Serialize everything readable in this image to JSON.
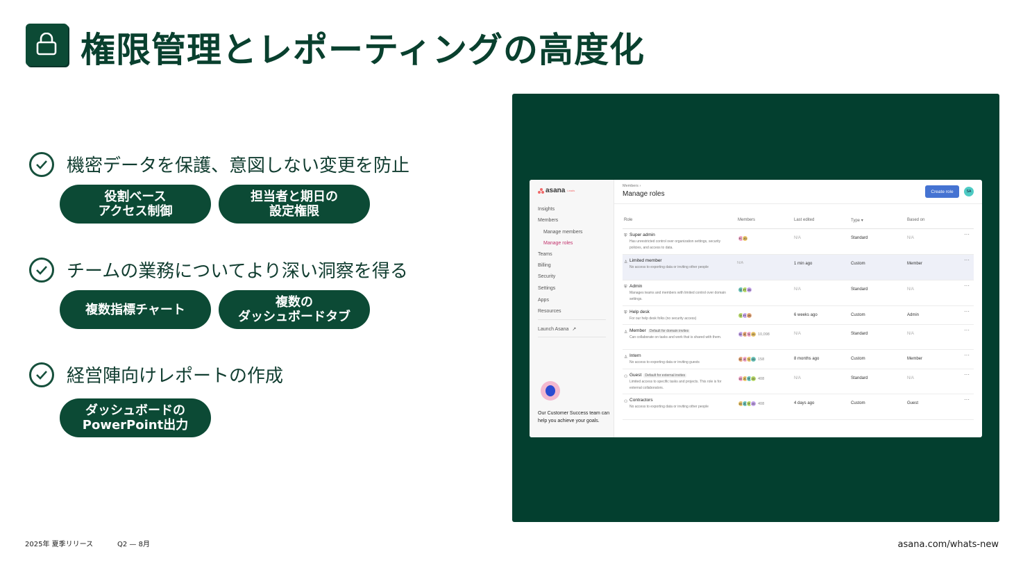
{
  "slide": {
    "title": "権限管理とレポーティングの高度化",
    "bullets": [
      {
        "text": "機密データを保護、意図しない変更を防止",
        "pills": [
          "役割ベース\nアクセス制御",
          "担当者と期日の\n設定権限"
        ]
      },
      {
        "text": "チームの業務についてより深い洞察を得る",
        "pills": [
          "複数指標チャート",
          "複数の\nダッシュボードタブ"
        ]
      },
      {
        "text": "経営陣向けレポートの作成",
        "pills": [
          "ダッシュボードの\nPowerPoint出力"
        ]
      }
    ],
    "footer": {
      "release": "2025年 夏季リリース",
      "period": "Q2 — 8月",
      "url": "asana.com/whats-new"
    },
    "colors": {
      "brand_dark": "#0c4a35",
      "panel": "#033f2f",
      "accent_blue": "#4573d2"
    }
  },
  "app": {
    "logo": "asana",
    "logo_tag": "Leads",
    "sidebar": {
      "items": [
        "Insights",
        "Members",
        "Manage members",
        "Manage roles",
        "Teams",
        "Billing",
        "Security",
        "Settings",
        "Apps",
        "Resources"
      ],
      "launch": "Launch Asana",
      "cs_text": "Our Customer Success team can help you achieve your goals."
    },
    "breadcrumb": "Members",
    "page_title": "Manage roles",
    "create_button": "Create role",
    "user_initials": "SA",
    "columns": [
      "Role",
      "Members",
      "Last edited",
      "Type",
      "Based on"
    ],
    "rows": [
      {
        "name": "Super admin",
        "badge": "",
        "desc": "Has unrestricted control over organization settings, security policies, and access to data.",
        "members": [
          "FG",
          "JD"
        ],
        "member_count": "",
        "last_edited": "N/A",
        "type": "Standard",
        "based_on": "N/A"
      },
      {
        "name": "Limited member",
        "badge": "",
        "desc": "No access to exporting data or inviting other people",
        "members": [],
        "member_count": "N/A",
        "last_edited": "1 min ago",
        "type": "Custom",
        "based_on": "Member"
      },
      {
        "name": "Admin",
        "badge": "",
        "desc": "Manages teams and members with limited control over domain settings.",
        "members": [
          "TA",
          "FF",
          "JB"
        ],
        "member_count": "",
        "last_edited": "N/A",
        "type": "Standard",
        "based_on": "N/A"
      },
      {
        "name": "Help desk",
        "badge": "",
        "desc": "For our help desk folks (no security access)",
        "members": [
          "TA",
          "FF",
          "JB"
        ],
        "member_count": "",
        "last_edited": "6 weeks ago",
        "type": "Custom",
        "based_on": "Admin"
      },
      {
        "name": "Member",
        "badge": "Default for domain invites",
        "desc": "Can collaborate on tasks and work that is shared with them.",
        "members": [
          "SN",
          "JD",
          "TA",
          "JD"
        ],
        "member_count": "10,098",
        "last_edited": "N/A",
        "type": "Standard",
        "based_on": "N/A"
      },
      {
        "name": "Intern",
        "badge": "",
        "desc": "No access to exporting data or inviting guests",
        "members": [
          "SN",
          "JD",
          "TA",
          "JD"
        ],
        "member_count": "158",
        "last_edited": "8 months ago",
        "type": "Custom",
        "based_on": "Member"
      },
      {
        "name": "Guest",
        "badge": "Default for external invites",
        "desc": "Limited access to specific tasks and projects. This role is for external collaborators.",
        "members": [
          "AB",
          "JD",
          "TP",
          "JD"
        ],
        "member_count": "408",
        "last_edited": "N/A",
        "type": "Standard",
        "based_on": "N/A"
      },
      {
        "name": "Contractors",
        "badge": "",
        "desc": "No access to exporting data or inviting other people",
        "members": [
          "AB",
          "JD",
          "TP",
          "JD"
        ],
        "member_count": "408",
        "last_edited": "4 days ago",
        "type": "Custom",
        "based_on": "Guest"
      }
    ]
  }
}
